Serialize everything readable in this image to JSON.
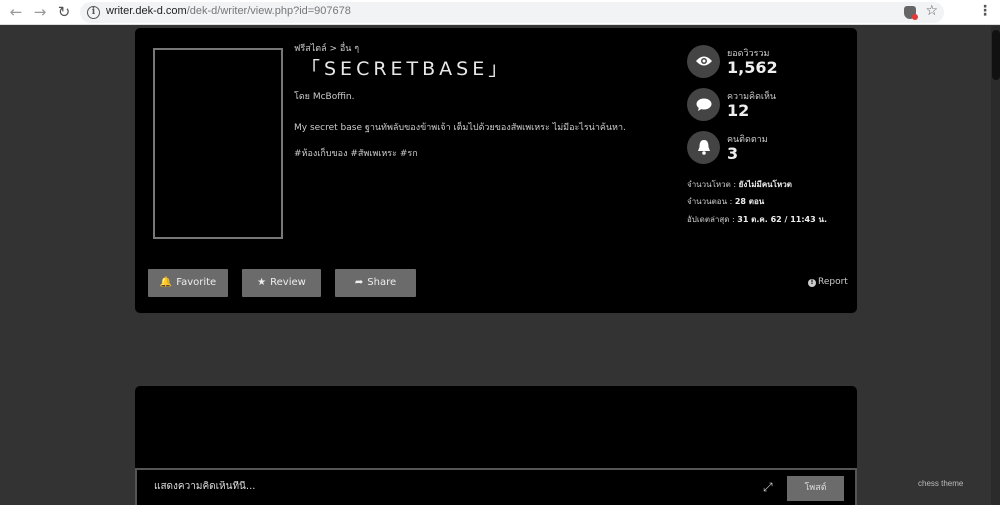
{
  "browser": {
    "url_domain": "writer.dek-d.com",
    "url_path": "/dek-d/writer/view.php?id=907678"
  },
  "story": {
    "breadcrumb": "ฟรีสไตล์ > อื่น ๆ",
    "title": "「SECRETBASE」",
    "author": "โดย McBoffin.",
    "description": "My secret base ฐานทัพลับของข้าพเจ้า เต็มไปด้วยของสัพเพเหระ ไม่มีอะไรน่าค้นหา.",
    "tags": "#ห้องเก็บของ #สัพเพเหระ #รก"
  },
  "stats": [
    {
      "label": "ยอดวิวรวม",
      "value": "1,562",
      "icon": "eye-icon"
    },
    {
      "label": "ความคิดเห็น",
      "value": "12",
      "icon": "speech-bubble-icon"
    },
    {
      "label": "คนติดตาม",
      "value": "3",
      "icon": "bell-icon"
    }
  ],
  "meta": {
    "votes_label": "จำนวนโหวต : ",
    "votes_value": "ยังไม่มีคนโหวต",
    "episodes_label": "จำนวนตอน : ",
    "episodes_value": "28 ตอน",
    "updated_label": "อัปเดตล่าสุด : ",
    "updated_value": " 31 ต.ค. 62 / 11:43 น."
  },
  "actions": {
    "favorite": "Favorite",
    "review": "Review",
    "share": "Share",
    "report": "Report"
  },
  "comment": {
    "placeholder": "แสดงความคิดเห็นที่นี่...",
    "post_label": "โพสต์"
  },
  "footer": {
    "theme_label": "chess theme"
  },
  "colors": {
    "page_bg": "#333333",
    "card_bg": "#000000",
    "button_bg": "#6b6b6b"
  }
}
